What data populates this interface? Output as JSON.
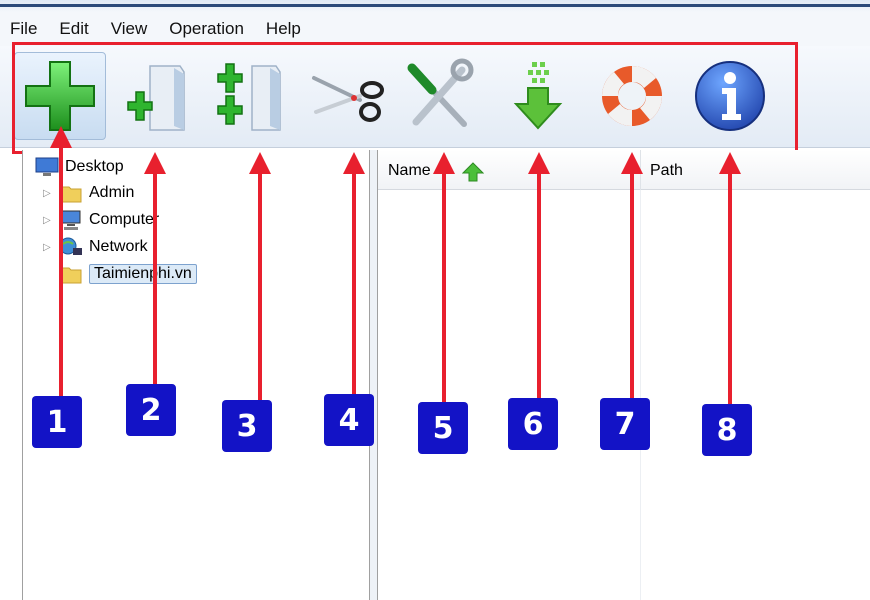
{
  "menubar": {
    "items": [
      {
        "label": "File"
      },
      {
        "label": "Edit"
      },
      {
        "label": "View"
      },
      {
        "label": "Operation"
      },
      {
        "label": "Help"
      }
    ]
  },
  "toolbar": {
    "buttons": [
      {
        "icon": "add-green-plus-icon"
      },
      {
        "icon": "add-file-icon"
      },
      {
        "icon": "add-multiple-files-icon"
      },
      {
        "icon": "scissors-icon"
      },
      {
        "icon": "tools-icon"
      },
      {
        "icon": "download-arrow-icon"
      },
      {
        "icon": "lifebuoy-help-icon"
      },
      {
        "icon": "info-icon"
      }
    ]
  },
  "tree": {
    "root": {
      "label": "Desktop"
    },
    "items": [
      {
        "label": "Admin"
      },
      {
        "label": "Computer"
      },
      {
        "label": "Network"
      },
      {
        "label": "Taimienphi.vn",
        "selected": true
      }
    ]
  },
  "list": {
    "columns": [
      {
        "label": "Name"
      },
      {
        "label": "Path"
      }
    ]
  },
  "annotations": {
    "badges": [
      "1",
      "2",
      "3",
      "4",
      "5",
      "6",
      "7",
      "8"
    ],
    "color": "#e8202e",
    "badge_color": "#1313c6"
  }
}
